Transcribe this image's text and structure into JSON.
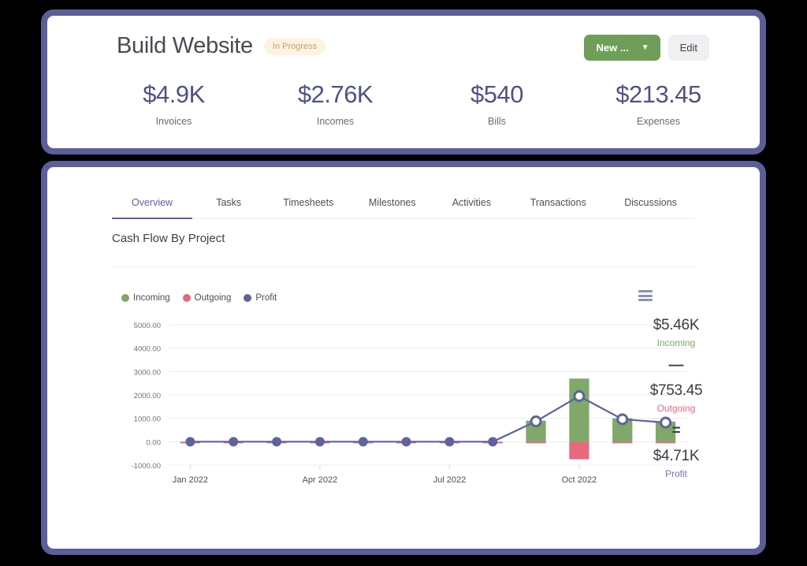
{
  "header": {
    "title": "Build Website",
    "status_badge": "In Progress",
    "new_button": "New ...",
    "new_button_icon": "chevron-down-icon",
    "edit_button": "Edit",
    "new_button_color": "#6e9e58"
  },
  "stats": [
    {
      "value": "$4.9K",
      "label": "Invoices"
    },
    {
      "value": "$2.76K",
      "label": "Incomes"
    },
    {
      "value": "$540",
      "label": "Bills"
    },
    {
      "value": "$213.45",
      "label": "Expenses"
    }
  ],
  "tabs": [
    {
      "label": "Overview",
      "active": true
    },
    {
      "label": "Tasks",
      "active": false
    },
    {
      "label": "Timesheets",
      "active": false
    },
    {
      "label": "Milestones",
      "active": false
    },
    {
      "label": "Activities",
      "active": false
    },
    {
      "label": "Transactions",
      "active": false
    },
    {
      "label": "Discussions",
      "active": false
    }
  ],
  "chart_panel": {
    "title": "Cash Flow By Project",
    "menu_icon": "hamburger-menu-icon"
  },
  "summary": {
    "incoming_value": "$5.46K",
    "incoming_label": "Incoming",
    "operator_minus": "—",
    "outgoing_value": "$753.45",
    "outgoing_label": "Outgoing",
    "operator_equals": "=",
    "profit_value": "$4.71K",
    "profit_label": "Profit"
  },
  "colors": {
    "incoming": "#7fa86a",
    "outgoing": "#e8697d",
    "profit": "#5f639c",
    "frame": "#5b5f98",
    "accent": "#5a5fa5"
  },
  "chart_data": {
    "type": "bar",
    "title": "Cash Flow By Project",
    "xlabel": "",
    "ylabel": "",
    "ylim": [
      -1000,
      5000
    ],
    "ytick_labels": [
      "5000.00",
      "4000.00",
      "3000.00",
      "2000.00",
      "1000.00",
      "0.00",
      "-1000.00"
    ],
    "ytick_values": [
      5000,
      4000,
      3000,
      2000,
      1000,
      0,
      -1000
    ],
    "grid": true,
    "legend_position": "top-left",
    "categories": [
      "Jan 2022",
      "Feb 2022",
      "Mar 2022",
      "Apr 2022",
      "May 2022",
      "Jun 2022",
      "Jul 2022",
      "Aug 2022",
      "Sep 2022",
      "Oct 2022",
      "Nov 2022",
      "Dec 2022"
    ],
    "xtick_labels": [
      "Jan 2022",
      "Apr 2022",
      "Jul 2022",
      "Oct 2022"
    ],
    "xtick_indices": [
      0,
      3,
      6,
      9
    ],
    "series": [
      {
        "name": "Incoming",
        "type": "bar",
        "color": "#7fa86a",
        "values": [
          0,
          0,
          0,
          0,
          0,
          0,
          0,
          0,
          900,
          2700,
          1000,
          860
        ]
      },
      {
        "name": "Outgoing",
        "type": "bar",
        "color": "#e8697d",
        "values": [
          -30,
          -20,
          -20,
          -20,
          -20,
          -20,
          -20,
          -30,
          -40,
          -750,
          -40,
          -40
        ]
      },
      {
        "name": "Profit",
        "type": "line",
        "color": "#5f639c",
        "values": [
          0,
          0,
          0,
          0,
          0,
          0,
          0,
          0,
          870,
          1950,
          960,
          820
        ]
      }
    ]
  }
}
